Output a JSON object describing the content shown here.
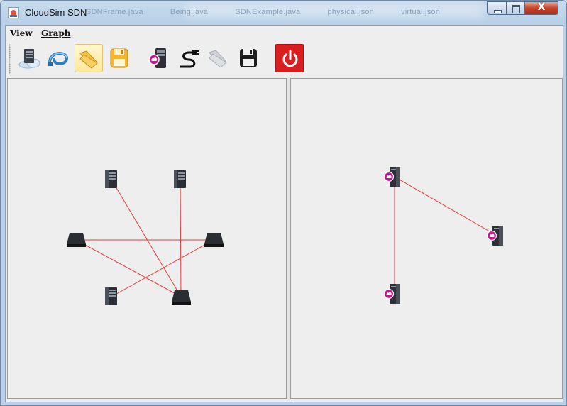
{
  "window": {
    "title": "CloudSim SDN",
    "background_tabs": [
      "SDNFrame.java",
      "Being.java",
      "SDNExample.java",
      "physical.json",
      "virtual.json"
    ],
    "controls": {
      "close": "X"
    }
  },
  "menubar": {
    "items": [
      {
        "label": "View",
        "icon": "none"
      },
      {
        "label": "Graph",
        "icon": "none"
      }
    ]
  },
  "toolbar": {
    "buttons": [
      {
        "name": "add-host-button",
        "icon": "host-cloud-icon"
      },
      {
        "name": "add-link-button",
        "icon": "cable-icon"
      },
      {
        "name": "open-button",
        "icon": "folder-open-icon"
      },
      {
        "name": "save-button",
        "icon": "floppy-yellow-icon"
      },
      {
        "name": "add-vm-button",
        "icon": "vm-server-icon"
      },
      {
        "name": "add-virtual-link-button",
        "icon": "plug-cable-icon"
      },
      {
        "name": "open-virtual-button",
        "icon": "folder-grey-icon",
        "disabled": true
      },
      {
        "name": "save-virtual-button",
        "icon": "floppy-black-icon"
      },
      {
        "name": "exit-button",
        "icon": "power-icon"
      }
    ]
  },
  "physical_graph": {
    "nodes": [
      {
        "id": "host-1",
        "kind": "host"
      },
      {
        "id": "host-2",
        "kind": "host"
      },
      {
        "id": "switch-1",
        "kind": "switch"
      },
      {
        "id": "switch-2",
        "kind": "switch"
      },
      {
        "id": "host-3",
        "kind": "host"
      },
      {
        "id": "switch-3",
        "kind": "switch"
      }
    ],
    "links": [
      [
        "host-1",
        "switch-3"
      ],
      [
        "host-2",
        "switch-3"
      ],
      [
        "switch-1",
        "switch-2"
      ],
      [
        "switch-1",
        "switch-3"
      ],
      [
        "switch-2",
        "host-3"
      ]
    ]
  },
  "virtual_graph": {
    "nodes": [
      {
        "id": "vm-1",
        "kind": "vm"
      },
      {
        "id": "vm-2",
        "kind": "vm"
      },
      {
        "id": "vm-3",
        "kind": "vm"
      }
    ],
    "links": [
      [
        "vm-1",
        "vm-2"
      ],
      [
        "vm-1",
        "vm-3"
      ]
    ]
  },
  "colors": {
    "link": "#e83a3a",
    "canvas": "#eeeeee",
    "vm_badge": "#c0188a",
    "power": "#d81e1e"
  }
}
